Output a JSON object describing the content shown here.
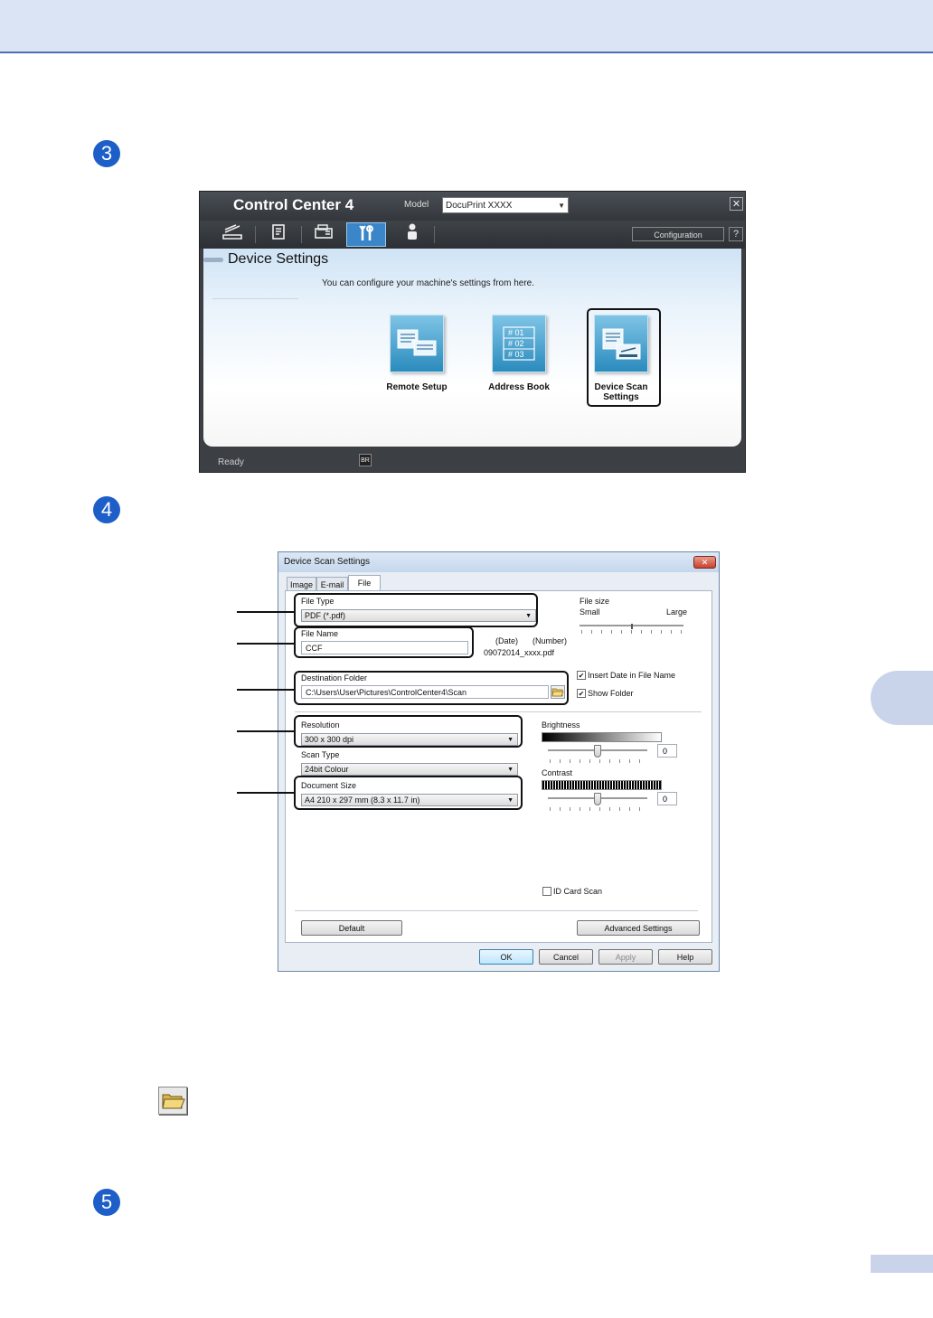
{
  "steps": [
    "3",
    "4",
    "5"
  ],
  "cc4": {
    "title": "Control Center 4",
    "model_label": "Model",
    "model_value": "DocuPrint XXXX",
    "close": "✕",
    "config_button": "Configuration",
    "help_button": "?",
    "heading": "Device Settings",
    "subtitle": "You can configure your machine's settings from here.",
    "tiles": [
      {
        "label": "Remote Setup"
      },
      {
        "label": "Address Book",
        "lines": [
          "# 01",
          "# 02",
          "# 03"
        ]
      },
      {
        "label_line1": "Device Scan",
        "label_line2": "Settings"
      }
    ],
    "status": "Ready",
    "status_icon": "BR"
  },
  "dialog": {
    "title": "Device Scan Settings",
    "close": "✕",
    "tabs": [
      "Image",
      "E-mail",
      "File"
    ],
    "file_type_label": "File Type",
    "file_type_value": "PDF (*.pdf)",
    "file_size_label": "File size",
    "file_size_small": "Small",
    "file_size_large": "Large",
    "file_name_label": "File Name",
    "file_name_value": "CCF",
    "date_label": "(Date)",
    "number_label": "(Number)",
    "file_name_example": "09072014_xxxx.pdf",
    "dest_label": "Destination Folder",
    "dest_value": "C:\\Users\\User\\Pictures\\ControlCenter4\\Scan",
    "insert_date_label": "Insert Date in File Name",
    "insert_date_checked": true,
    "show_folder_label": "Show Folder",
    "show_folder_checked": true,
    "resolution_label": "Resolution",
    "resolution_value": "300 x 300 dpi",
    "scan_type_label": "Scan Type",
    "scan_type_value": "24bit Colour",
    "doc_size_label": "Document Size",
    "doc_size_value": "A4 210 x 297 mm (8.3 x 11.7 in)",
    "brightness_label": "Brightness",
    "brightness_value": "0",
    "contrast_label": "Contrast",
    "contrast_value": "0",
    "id_card_label": "ID Card Scan",
    "id_card_checked": false,
    "default_button": "Default",
    "advanced_button": "Advanced Settings",
    "ok_button": "OK",
    "cancel_button": "Cancel",
    "apply_button": "Apply",
    "help_button": "Help"
  },
  "icons": {
    "folder": "folder-open-icon"
  }
}
